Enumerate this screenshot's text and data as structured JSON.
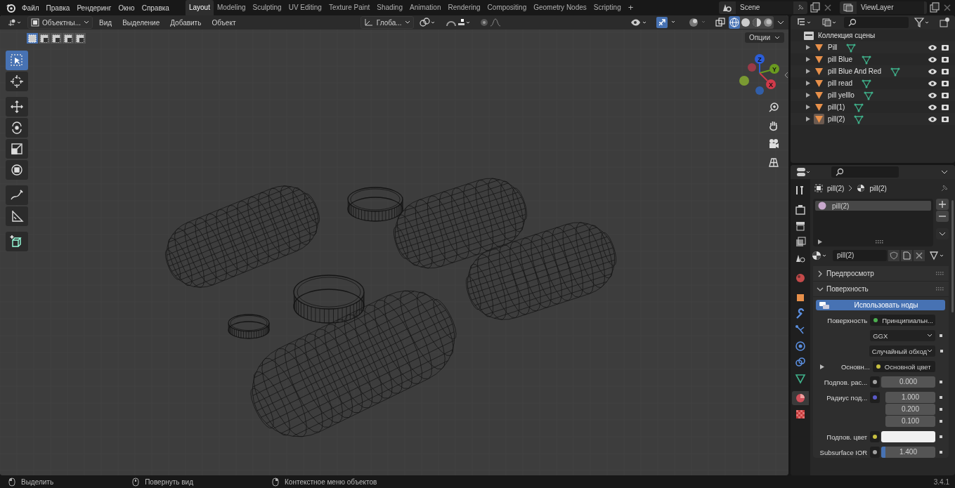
{
  "menu": [
    "Файл",
    "Правка",
    "Рендеринг",
    "Окно",
    "Справка"
  ],
  "workspaces": [
    {
      "label": "Layout",
      "selected": true
    },
    {
      "label": "Modeling",
      "selected": false
    },
    {
      "label": "Sculpting",
      "selected": false
    },
    {
      "label": "UV Editing",
      "selected": false
    },
    {
      "label": "Texture Paint",
      "selected": false
    },
    {
      "label": "Shading",
      "selected": false
    },
    {
      "label": "Animation",
      "selected": false
    },
    {
      "label": "Rendering",
      "selected": false
    },
    {
      "label": "Compositing",
      "selected": false
    },
    {
      "label": "Geometry Nodes",
      "selected": false
    },
    {
      "label": "Scripting",
      "selected": false
    }
  ],
  "add_workspace": "+",
  "scene": "Scene",
  "view_layer": "ViewLayer",
  "viewport": {
    "mode": "Объектны...",
    "menus": [
      "Вид",
      "Выделение",
      "Добавить",
      "Объект"
    ],
    "orientation": "Глоба...",
    "options": "Опции",
    "select_modes": [
      {
        "selected": true
      },
      {
        "selected": false
      },
      {
        "selected": false
      },
      {
        "selected": false
      },
      {
        "selected": false
      }
    ],
    "shading": [
      {
        "kind": "wireframe",
        "selected": true
      },
      {
        "kind": "solid",
        "selected": false
      },
      {
        "kind": "material",
        "selected": false
      },
      {
        "kind": "rendered",
        "selected": false
      }
    ],
    "tools": [
      {
        "kind": "select",
        "selected": true
      },
      {
        "kind": "cursor",
        "selected": false
      },
      {
        "kind": "move",
        "selected": false
      },
      {
        "kind": "rotate",
        "selected": false
      },
      {
        "kind": "scale",
        "selected": false
      },
      {
        "kind": "transform",
        "selected": false
      },
      {
        "kind": "annotate",
        "selected": false
      },
      {
        "kind": "measure",
        "selected": false
      },
      {
        "kind": "add-cube",
        "selected": false
      }
    ],
    "gizmo": {
      "z": "Z",
      "y": "Y",
      "x": "X"
    }
  },
  "outliner": {
    "collection": "Коллекция сцены",
    "items": [
      {
        "name": "Pill",
        "selected": false
      },
      {
        "name": "pill Blue",
        "selected": false
      },
      {
        "name": "pill Blue And Red",
        "selected": false
      },
      {
        "name": "pill read",
        "selected": false
      },
      {
        "name": "pill yelllo",
        "selected": false
      },
      {
        "name": "pill(1)",
        "selected": false
      },
      {
        "name": "pill(2)",
        "selected": true
      }
    ]
  },
  "properties": {
    "tabs": [
      {
        "kind": "tool",
        "selected": false
      },
      {
        "kind": "render",
        "selected": false
      },
      {
        "kind": "output",
        "selected": false
      },
      {
        "kind": "view-layer",
        "selected": false
      },
      {
        "kind": "scene",
        "selected": false
      },
      {
        "kind": "world",
        "selected": false
      },
      {
        "kind": "object",
        "selected": false
      },
      {
        "kind": "modifier",
        "selected": false
      },
      {
        "kind": "particles",
        "selected": false
      },
      {
        "kind": "physics",
        "selected": false
      },
      {
        "kind": "constraints",
        "selected": false
      },
      {
        "kind": "data",
        "selected": false
      },
      {
        "kind": "material",
        "selected": true
      },
      {
        "kind": "texture",
        "selected": false
      }
    ],
    "breadcrumb_object": "pill(2)",
    "breadcrumb_material": "pill(2)",
    "slots": [
      {
        "name": "pill(2)",
        "selected": true
      }
    ],
    "material": "pill(2)",
    "panels": [
      {
        "title": "Предпросмотр",
        "expanded": false
      },
      {
        "title": "Поверхность",
        "expanded": true
      }
    ],
    "use_nodes": "Использовать ноды",
    "rows": [
      {
        "kind": "link",
        "label": "Поверхность",
        "value": "Принципиальн...",
        "color": "#4caf50"
      },
      {
        "kind": "dropdown",
        "value": "GGX"
      },
      {
        "kind": "dropdown",
        "value": "Случайный обход"
      },
      {
        "kind": "link",
        "label": "Основн...",
        "value": "Основной цвет",
        "color": "#c8c040",
        "expandable": true
      },
      {
        "kind": "number",
        "label": "Подпов. рас...",
        "value": "0.000",
        "color": "#a0a0a0"
      },
      {
        "kind": "vector",
        "label": "Радиус под...",
        "values": [
          "1.000",
          "0.200",
          "0.100"
        ],
        "color": "#5a5ac8"
      },
      {
        "kind": "swatch",
        "label": "Подпов. цвет",
        "color": "#c8c040"
      },
      {
        "kind": "slider",
        "label": "Subsurface IOR",
        "value": "1.400",
        "level": 0.07,
        "color": "#a0a0a0"
      }
    ]
  },
  "status_bar": [
    "Выделить",
    "Повернуть вид",
    "Контекстное меню объектов"
  ],
  "version": "3.4.1"
}
